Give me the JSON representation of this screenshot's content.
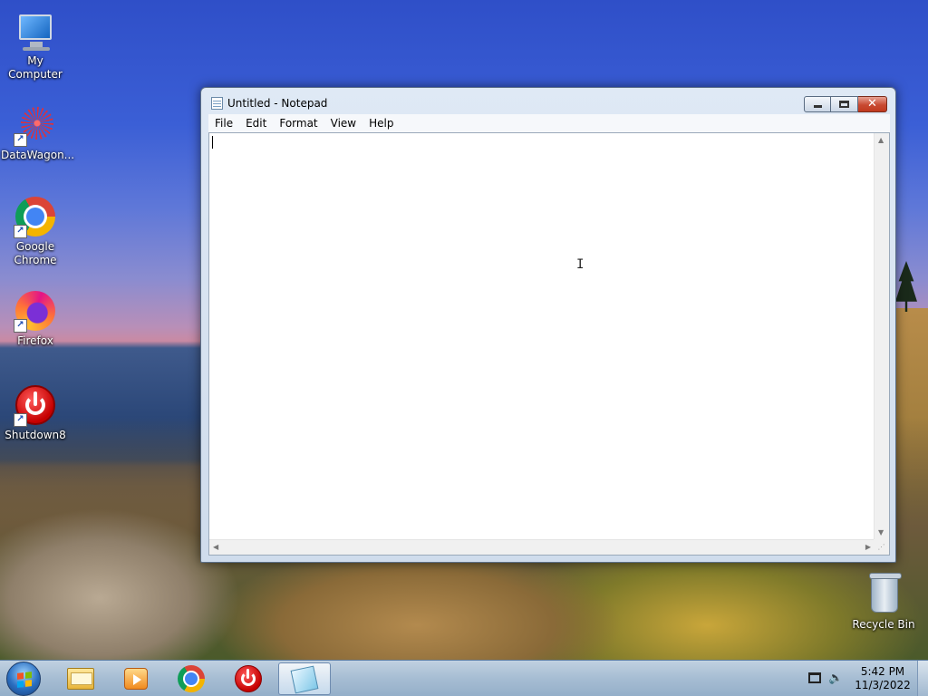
{
  "desktop": {
    "icons": [
      {
        "label": "My Computer",
        "icon": "computer-icon"
      },
      {
        "label": "DataWagon...",
        "icon": "datawagon-icon"
      },
      {
        "label": "Google Chrome",
        "icon": "chrome-icon"
      },
      {
        "label": "Firefox",
        "icon": "firefox-icon"
      },
      {
        "label": "Shutdown8",
        "icon": "power-icon"
      },
      {
        "label": "Recycle Bin",
        "icon": "recycle-bin-icon"
      }
    ],
    "shortcut_glyph": "↗"
  },
  "window": {
    "title": "Untitled - Notepad",
    "menu": [
      "File",
      "Edit",
      "Format",
      "View",
      "Help"
    ],
    "content": "",
    "controls": {
      "close_glyph": "✕"
    },
    "scroll_arrows": {
      "up": "▲",
      "down": "▼",
      "left": "◀",
      "right": "▶",
      "grip": "⋰"
    }
  },
  "taskbar": {
    "apps": [
      "windows-explorer-icon",
      "media-player-icon",
      "chrome-icon",
      "power-icon",
      "notepad-icon"
    ],
    "tray": {
      "volume_glyph": "🔈"
    },
    "clock": {
      "time": "5:42 PM",
      "date": "11/3/2022"
    }
  },
  "colors": {
    "accent": "#2b6fc1",
    "close_button": "#c84a32",
    "taskbar": "#aac3dc"
  }
}
